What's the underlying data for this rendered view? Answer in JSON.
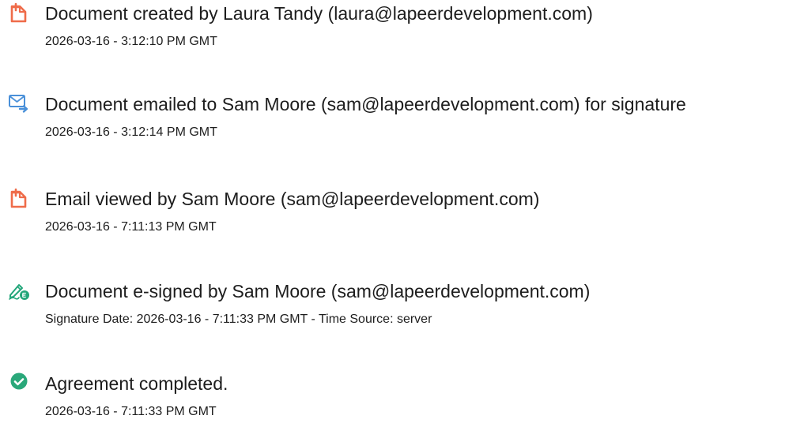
{
  "events": [
    {
      "icon": "document-created-icon",
      "color": "#ef6c4a",
      "title": "Document created by Laura Tandy (laura@lapeerdevelopment.com)",
      "detail": "2026-03-16 - 3:12:10 PM GMT"
    },
    {
      "icon": "envelope-sent-icon",
      "color": "#4a90d9",
      "title": "Document emailed to Sam Moore (sam@lapeerdevelopment.com) for signature",
      "detail": "2026-03-16 - 3:12:14 PM GMT"
    },
    {
      "icon": "email-viewed-icon",
      "color": "#ef6c4a",
      "title": "Email viewed by Sam Moore (sam@lapeerdevelopment.com)",
      "detail": "2026-03-16 - 7:11:13 PM GMT"
    },
    {
      "icon": "pen-signature-icon",
      "color": "#23a67a",
      "title": "Document e-signed by Sam Moore (sam@lapeerdevelopment.com)",
      "detail": "Signature Date: 2026-03-16 - 7:11:33 PM GMT - Time Source: server"
    },
    {
      "icon": "check-circle-icon",
      "color": "#2aa87a",
      "title": "Agreement completed.",
      "detail": "2026-03-16 - 7:11:33 PM GMT"
    }
  ]
}
